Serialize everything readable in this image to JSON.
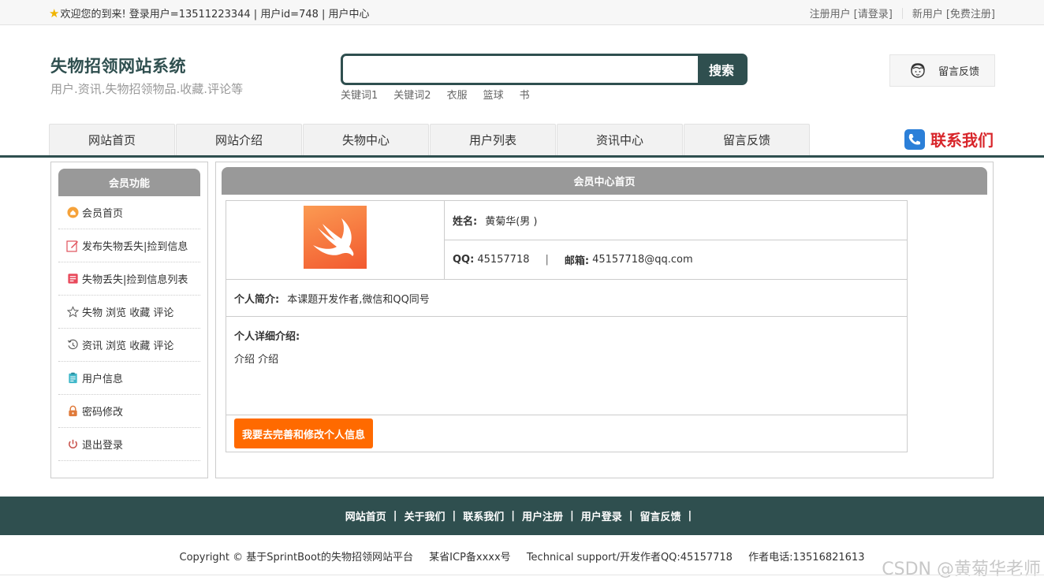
{
  "topbar": {
    "welcome": "欢迎您的到来!  登录用户=13511223344 | 用户id=748 | 用户中心",
    "register_label": "注册用户",
    "login_link": "[请登录]",
    "new_user_label": "新用户",
    "signup_link": "[免费注册]"
  },
  "header": {
    "title": "失物招领网站系统",
    "subtitle": "用户.资讯.失物招领物品.收藏.评论等",
    "search_placeholder": "",
    "search_button": "搜索",
    "keywords": [
      "关键词1",
      "关键词2",
      "衣服",
      "篮球",
      "书"
    ],
    "feedback": "留言反馈"
  },
  "nav": {
    "items": [
      "网站首页",
      "网站介绍",
      "失物中心",
      "用户列表",
      "资讯中心",
      "留言反馈"
    ],
    "contact": "联系我们"
  },
  "sidebar": {
    "title": "会员功能",
    "items": [
      {
        "label": "会员首页",
        "icon": "home-icon"
      },
      {
        "label": "发布失物丢失|捡到信息",
        "icon": "edit-icon"
      },
      {
        "label": "失物丢失|捡到信息列表",
        "icon": "list-icon"
      },
      {
        "label": "失物 浏览 收藏 评论",
        "icon": "star-icon"
      },
      {
        "label": "资讯 浏览 收藏 评论",
        "icon": "history-icon"
      },
      {
        "label": "用户信息",
        "icon": "clipboard-icon"
      },
      {
        "label": "密码修改",
        "icon": "lock-icon"
      },
      {
        "label": "退出登录",
        "icon": "power-icon"
      }
    ]
  },
  "main": {
    "title": "会员中心首页",
    "name_label": "姓名:",
    "name_value": "黄菊华(男 )",
    "qq_label": "QQ:",
    "qq_value": "45157718",
    "divider": "|",
    "email_label": "邮箱:",
    "email_value": "45157718@qq.com",
    "bio_label": "个人简介:",
    "bio_value": "本课题开发作者,微信和QQ同号",
    "detail_label": "个人详细介绍:",
    "detail_value": "介绍  介绍",
    "edit_button": "我要去完善和修改个人信息"
  },
  "footer": {
    "links": [
      "网站首页",
      "关于我们",
      "联系我们",
      "用户注册",
      "用户登录",
      "留言反馈"
    ],
    "separator": "|",
    "copyright": "Copyright © 基于SprintBoot的失物招领网站平台",
    "icp": "某省ICP备xxxx号",
    "support": "Technical support/开发作者QQ:45157718",
    "phone": "作者电话:13516821613",
    "watermark": "CSDN @黄菊华老师"
  },
  "colors": {
    "primary": "#2f4f4f",
    "accent": "#ff6a00",
    "contact_red": "#d8262b",
    "panel_header": "#999999"
  }
}
